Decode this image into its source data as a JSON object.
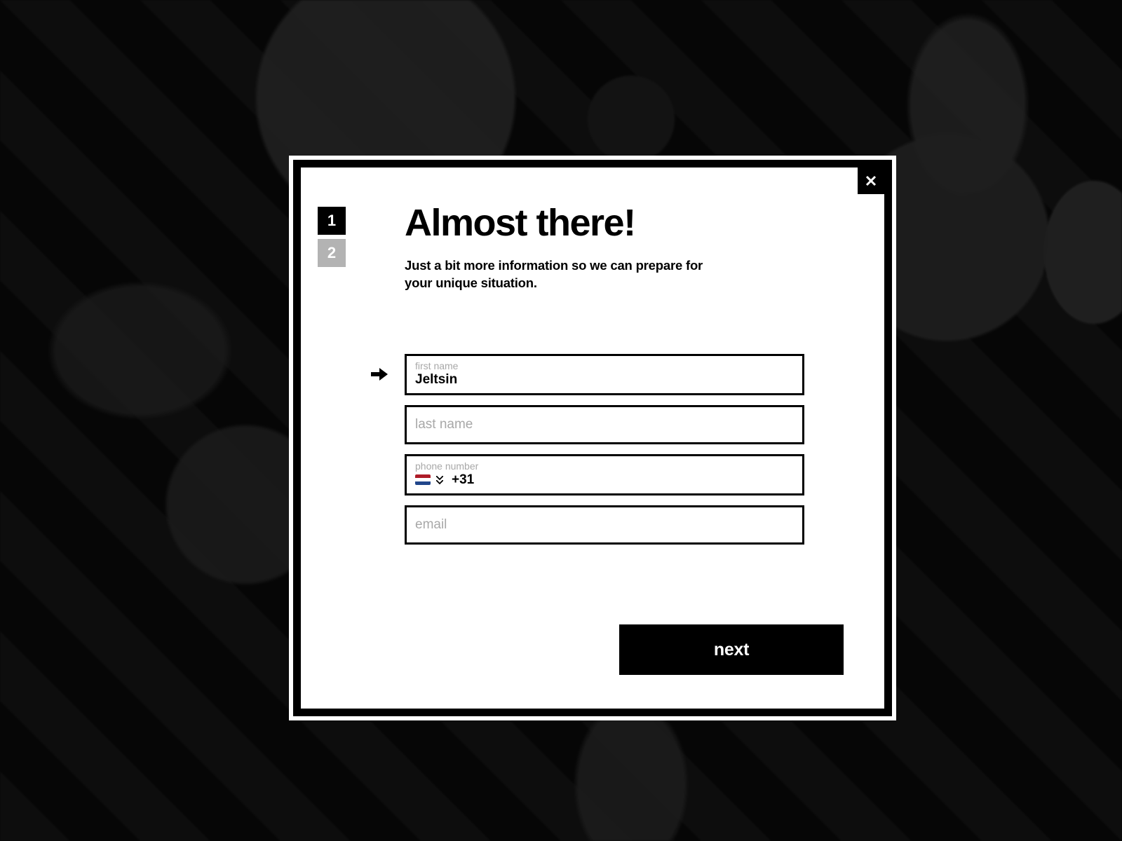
{
  "modal": {
    "title": "Almost there!",
    "subtitle": "Just a bit more information so we can prepare for your unique situation.",
    "close_label": "close"
  },
  "steps": {
    "one": "1",
    "two": "2",
    "active_index": 0
  },
  "form": {
    "first_name": {
      "label": "first name",
      "value": "Jeltsin"
    },
    "last_name": {
      "placeholder": "last name",
      "value": ""
    },
    "phone": {
      "label": "phone number",
      "country": "NL",
      "dial_code": "+31",
      "value": ""
    },
    "email": {
      "placeholder": "email",
      "value": ""
    }
  },
  "actions": {
    "next": "next"
  }
}
